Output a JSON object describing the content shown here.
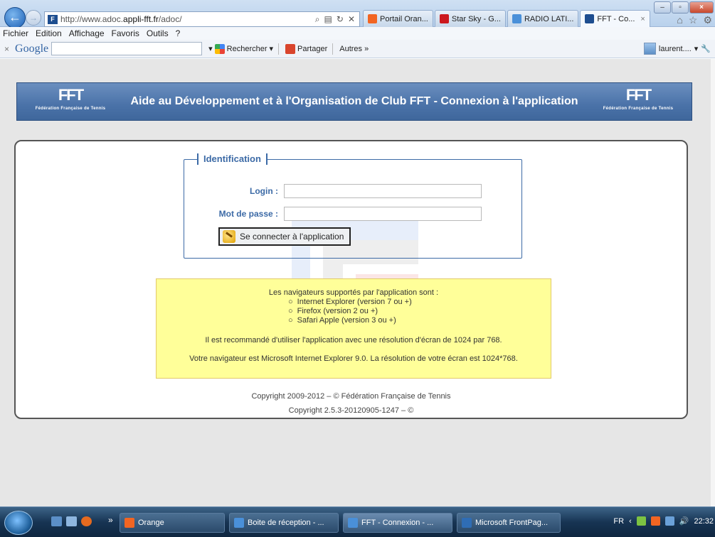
{
  "browser": {
    "address": {
      "prefix": "http://www.adoc.",
      "domain": "appli-fft.fr",
      "path": "/adoc/"
    },
    "address_icons": [
      "search-icon",
      "compat-icon",
      "refresh-icon",
      "stop-icon"
    ],
    "tabs": [
      {
        "label": "Portail Oran...",
        "color": "#f26522"
      },
      {
        "label": "Star Sky - G...",
        "color": "#cc181e"
      },
      {
        "label": "RADIO LATI...",
        "color": "#4a90d9"
      },
      {
        "label": "FFT - Co...",
        "color": "#1d4d8f",
        "active": true
      }
    ],
    "tab_close": "×",
    "menu": [
      "Fichier",
      "Edition",
      "Affichage",
      "Favoris",
      "Outils",
      "?"
    ],
    "google": {
      "close": "×",
      "logo": "Google",
      "search_button": "Rechercher",
      "share_button": "Partager",
      "more": "Autres »",
      "user": "laurent...."
    },
    "window_buttons": {
      "min": "–",
      "max": "▫",
      "close": "×"
    }
  },
  "page": {
    "banner": {
      "title": "Aide au Développement et à l'Organisation de Club FFT - Connexion à l'application",
      "logo_mark": "FFT",
      "logo_caption": "Fédération Française de Tennis"
    },
    "login_form": {
      "legend": "Identification",
      "login_label": "Login :",
      "login_value": "",
      "password_label": "Mot de passe :",
      "password_value": "",
      "submit": "Se connecter à l'application"
    },
    "info": {
      "heading": "Les navigateurs supportés par l'application sont :",
      "browsers": [
        "Internet Explorer (version 7 ou +)",
        "Firefox (version 2 ou +)",
        "Safari Apple (version 3 ou +)"
      ],
      "recommendation": "Il est recommandé d'utiliser l'application avec une résolution d'écran de 1024 par 768.",
      "detected": "Votre navigateur est Microsoft Internet Explorer 9.0. La résolution de votre écran est 1024*768."
    },
    "footer": {
      "copyright": "Copyright 2009-2012 – © Fédération Française de Tennis",
      "version": "Copyright 2.5.3-20120905-1247 – ©"
    }
  },
  "taskbar": {
    "tasks": [
      {
        "label": "Orange",
        "color": "#f26522"
      },
      {
        "label": "Boite de réception - ...",
        "color": "#4a90d9"
      },
      {
        "label": "FFT - Connexion - ...",
        "color": "#4a90d9",
        "active": true
      },
      {
        "label": "Microsoft FrontPag...",
        "color": "#2f6db5"
      }
    ],
    "lang": "FR",
    "clock": "22:32",
    "chevron": "»"
  }
}
